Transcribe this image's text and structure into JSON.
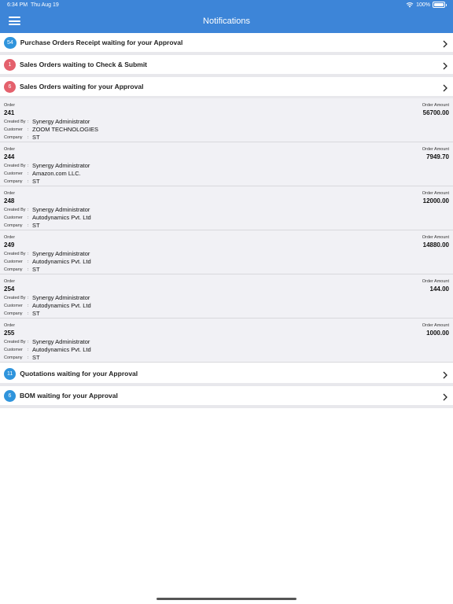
{
  "status_bar": {
    "time": "6:34 PM",
    "date": "Thu Aug 19",
    "battery_percent": "100%",
    "battery_level": 1.0
  },
  "header": {
    "title": "Notifications"
  },
  "colors": {
    "header_bg": "#3d85d8",
    "badge_blue": "#2f94dc",
    "badge_red": "#e4616d"
  },
  "sections": [
    {
      "badge": "54",
      "badge_color": "#2f94dc",
      "label": "Purchase Orders Receipt waiting for your Approval"
    },
    {
      "badge": "1",
      "badge_color": "#e4616d",
      "label": "Sales Orders waiting to Check & Submit"
    },
    {
      "badge": "6",
      "badge_color": "#e4616d",
      "label": "Sales Orders waiting for your Approval"
    }
  ],
  "order_labels": {
    "order": "Order",
    "amount": "Order Amount",
    "created_by": "Created By",
    "customer": "Customer",
    "company": "Company",
    "sep": ":"
  },
  "orders": [
    {
      "order": "241",
      "amount": "56700.00",
      "created_by": "Synergy Administrator",
      "customer": "ZOOM TECHNOLOGIES",
      "company": "ST"
    },
    {
      "order": "244",
      "amount": "7949.70",
      "created_by": "Synergy Administrator",
      "customer": "Amazon.com LLC.",
      "company": "ST"
    },
    {
      "order": "248",
      "amount": "12000.00",
      "created_by": "Synergy Administrator",
      "customer": "Autodynamics Pvt. Ltd",
      "company": "ST"
    },
    {
      "order": "249",
      "amount": "14880.00",
      "created_by": "Synergy Administrator",
      "customer": "Autodynamics Pvt. Ltd",
      "company": "ST"
    },
    {
      "order": "254",
      "amount": "144.00",
      "created_by": "Synergy Administrator",
      "customer": "Autodynamics Pvt. Ltd",
      "company": "ST"
    },
    {
      "order": "255",
      "amount": "1000.00",
      "created_by": "Synergy Administrator",
      "customer": "Autodynamics Pvt. Ltd",
      "company": "ST"
    }
  ],
  "bottom_sections": [
    {
      "badge": "11",
      "badge_color": "#2f94dc",
      "label": "Quotations waiting for your Approval"
    },
    {
      "badge": "6",
      "badge_color": "#2f94dc",
      "label": "BOM waiting for your Approval"
    }
  ]
}
